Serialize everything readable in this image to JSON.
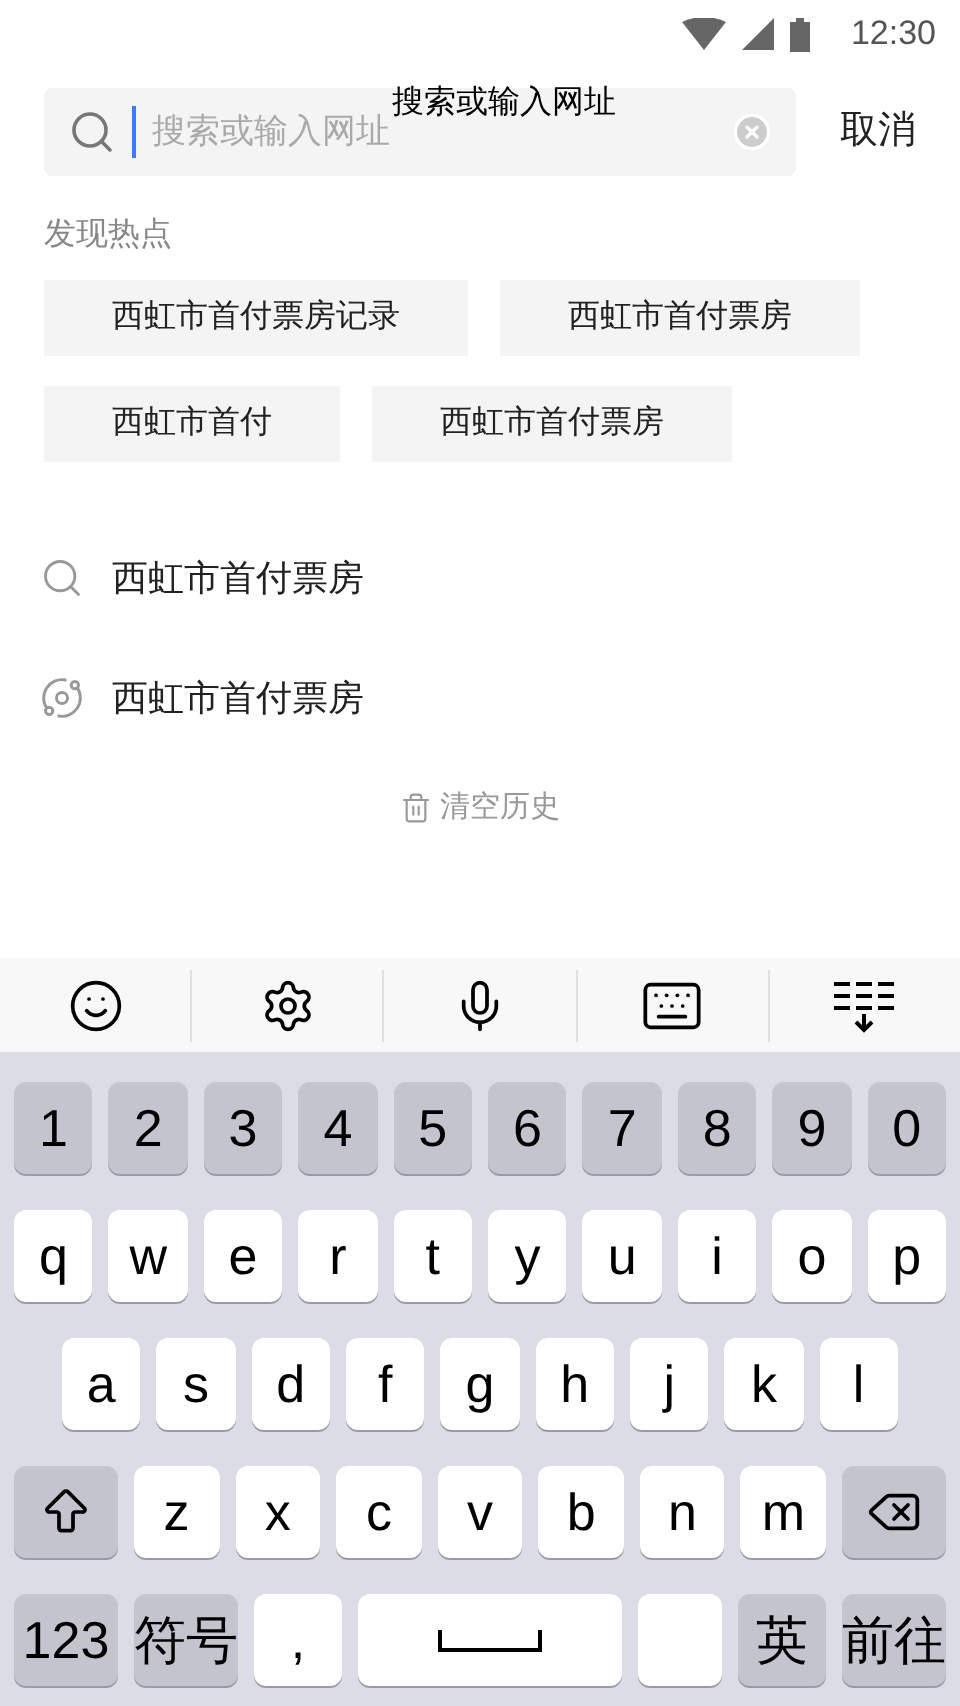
{
  "status_bar": {
    "time": "12:30"
  },
  "search": {
    "placeholder": "搜索或输入网址",
    "floating_hint": "搜索或输入网址",
    "cancel": "取消"
  },
  "hot": {
    "title": "发现热点",
    "items": [
      "西虹市首付票房记录",
      "西虹市首付票房",
      "西虹市首付",
      "西虹市首付票房"
    ]
  },
  "history": [
    {
      "kind": "search",
      "text": "西虹市首付票房"
    },
    {
      "kind": "planet",
      "text": "西虹市首付票房"
    }
  ],
  "clear_history": "清空历史",
  "keyboard": {
    "toolbar": [
      {
        "kind": "emoji"
      },
      {
        "kind": "settings"
      },
      {
        "kind": "mic"
      },
      {
        "kind": "keyboard"
      },
      {
        "kind": "collapse"
      }
    ],
    "rows": [
      {
        "keys": [
          {
            "label": "1",
            "kind": "gray"
          },
          {
            "label": "2",
            "kind": "gray"
          },
          {
            "label": "3",
            "kind": "gray"
          },
          {
            "label": "4",
            "kind": "gray"
          },
          {
            "label": "5",
            "kind": "gray"
          },
          {
            "label": "6",
            "kind": "gray"
          },
          {
            "label": "7",
            "kind": "gray"
          },
          {
            "label": "8",
            "kind": "gray"
          },
          {
            "label": "9",
            "kind": "gray"
          },
          {
            "label": "0",
            "kind": "gray"
          }
        ]
      },
      {
        "keys": [
          {
            "label": "q",
            "kind": "char"
          },
          {
            "label": "w",
            "kind": "char"
          },
          {
            "label": "e",
            "kind": "char"
          },
          {
            "label": "r",
            "kind": "char"
          },
          {
            "label": "t",
            "kind": "char"
          },
          {
            "label": "y",
            "kind": "char"
          },
          {
            "label": "u",
            "kind": "char"
          },
          {
            "label": "i",
            "kind": "char"
          },
          {
            "label": "o",
            "kind": "char"
          },
          {
            "label": "p",
            "kind": "char"
          }
        ]
      },
      {
        "keys": [
          {
            "label": "a",
            "kind": "char"
          },
          {
            "label": "s",
            "kind": "char"
          },
          {
            "label": "d",
            "kind": "char"
          },
          {
            "label": "f",
            "kind": "char"
          },
          {
            "label": "g",
            "kind": "char"
          },
          {
            "label": "h",
            "kind": "char"
          },
          {
            "label": "j",
            "kind": "char"
          },
          {
            "label": "k",
            "kind": "char"
          },
          {
            "label": "l",
            "kind": "char"
          }
        ]
      },
      {
        "keys": [
          {
            "kind": "shift"
          },
          {
            "label": "z",
            "kind": "char"
          },
          {
            "label": "x",
            "kind": "char"
          },
          {
            "label": "c",
            "kind": "char"
          },
          {
            "label": "v",
            "kind": "char"
          },
          {
            "label": "b",
            "kind": "char"
          },
          {
            "label": "n",
            "kind": "char"
          },
          {
            "label": "m",
            "kind": "char"
          },
          {
            "kind": "backspace"
          }
        ]
      },
      {
        "keys": [
          {
            "label": "123",
            "kind": "gray_wide"
          },
          {
            "label": "符号",
            "kind": "gray_wide"
          },
          {
            "label": ",",
            "kind": "char"
          },
          {
            "kind": "space"
          },
          {
            "kind": "blank"
          },
          {
            "label": "英",
            "kind": "gray"
          },
          {
            "label": "前往",
            "kind": "gray_wide"
          }
        ]
      }
    ]
  }
}
